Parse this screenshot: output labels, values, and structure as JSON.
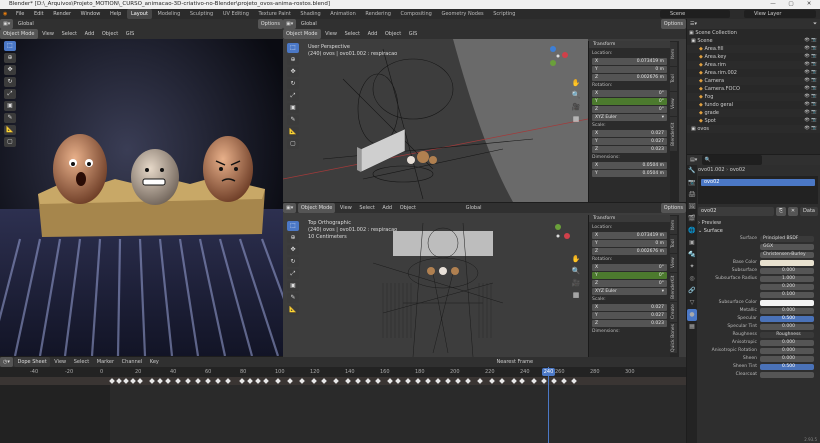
{
  "title": "Blender* [D:\\_Arquivos\\Projeto_MOTION\\_CURSO_animacao-3D-criativo-no-Blender\\projeto_ovos-anima-rostos.blend]",
  "window_controls": [
    "—",
    "▢",
    "✕"
  ],
  "menu": [
    "File",
    "Edit",
    "Render",
    "Window",
    "Help"
  ],
  "workspaces": [
    "Layout",
    "Modeling",
    "Sculpting",
    "UV Editing",
    "Texture Paint",
    "Shading",
    "Animation",
    "Rendering",
    "Compositing",
    "Geometry Nodes",
    "Scripting"
  ],
  "scene": {
    "name": "Scene",
    "view_layer": "View Layer"
  },
  "camera_view": {
    "header": [
      "Global",
      "Options"
    ],
    "header2": [
      "Object Mode",
      "View",
      "Select",
      "Add",
      "Object",
      "GIS"
    ]
  },
  "viewport_top": {
    "mode": "Object Mode",
    "menus": [
      "View",
      "Select",
      "Add",
      "Object"
    ],
    "gis": "GIS",
    "orientation": "Global",
    "options": "Options",
    "view_name": "User Perspective",
    "info": "(240) ovos | ovo01.002 : respiracao",
    "panel": {
      "title": "Transform",
      "location_label": "Location:",
      "location": [
        [
          "X",
          "0.073419 m"
        ],
        [
          "Y",
          "0 m"
        ],
        [
          "Z",
          "0.002676 m"
        ]
      ],
      "rotation_label": "Rotation:",
      "rotation": [
        [
          "X",
          "0°"
        ],
        [
          "Y",
          "0°"
        ],
        [
          "Z",
          "0°"
        ]
      ],
      "rotation_mode": "XYZ Euler",
      "scale_label": "Scale:",
      "scale": [
        [
          "X",
          "0.027"
        ],
        [
          "Y",
          "0.027"
        ],
        [
          "Z",
          "0.023"
        ]
      ],
      "dimensions_label": "Dimensions:",
      "dimensions": [
        [
          "X",
          "0.0504 m"
        ],
        [
          "Y",
          "0.0504 m"
        ]
      ]
    },
    "tabs": [
      "Item",
      "Tool",
      "View",
      "BlenderKit"
    ]
  },
  "viewport_bottom": {
    "mode": "Object Mode",
    "menus": [
      "View",
      "Select",
      "Add",
      "Object"
    ],
    "gis": "GIS",
    "orientation": "Global",
    "options": "Options",
    "view_name": "Top Orthographic",
    "info": "(240) ovos | ovo01.002 : respiracao",
    "scale_info": "10 Centimeters",
    "panel": {
      "title": "Transform",
      "location_label": "Location:",
      "location": [
        [
          "X",
          "0.073419 m"
        ],
        [
          "Y",
          "0 m"
        ],
        [
          "Z",
          "0.002676 m"
        ]
      ],
      "rotation_label": "Rotation:",
      "rotation": [
        [
          "X",
          "0°"
        ],
        [
          "Y",
          "0°"
        ],
        [
          "Z",
          "0°"
        ]
      ],
      "rotation_mode": "XYZ Euler",
      "scale_label": "Scale:",
      "scale": [
        [
          "X",
          "0.027"
        ],
        [
          "Y",
          "0.027"
        ],
        [
          "Z",
          "0.023"
        ]
      ],
      "dimensions_label": "Dimensions:"
    },
    "tabs": [
      "Item",
      "Tool",
      "View",
      "BlenderKit",
      "Create",
      "Quick Bones"
    ]
  },
  "outliner": {
    "title": "Scene Collection",
    "items": [
      {
        "name": "Scene",
        "indent": 0
      },
      {
        "name": "Area.fill",
        "indent": 1
      },
      {
        "name": "Area.key",
        "indent": 1
      },
      {
        "name": "Area.rim",
        "indent": 1
      },
      {
        "name": "Area.rim.002",
        "indent": 1
      },
      {
        "name": "Camera",
        "indent": 1
      },
      {
        "name": "Camera.FOCO",
        "indent": 1
      },
      {
        "name": "Fog",
        "indent": 1
      },
      {
        "name": "fundo geral",
        "indent": 1
      },
      {
        "name": "grade",
        "indent": 1
      },
      {
        "name": "Spot",
        "indent": 1
      },
      {
        "name": "ovos",
        "indent": 0
      }
    ]
  },
  "properties": {
    "object": "ovo01.002",
    "material_tab": "ovo02",
    "slot": "ovo02",
    "material_name": "ovo02",
    "data_label": "Data",
    "preview_label": "Preview",
    "surface_label": "Surface",
    "surface_shader": "Principled BSDF",
    "distribution": "GGX",
    "subsurface_method": "Christensen-Burley",
    "rows": [
      {
        "label": "Base Color",
        "value": "",
        "style": "light"
      },
      {
        "label": "Subsurface",
        "value": "0.000",
        "style": "norm"
      },
      {
        "label": "Subsurface Radius",
        "value": "1.000",
        "style": "norm"
      },
      {
        "label": "",
        "value": "0.200",
        "style": "norm"
      },
      {
        "label": "",
        "value": "0.100",
        "style": "norm"
      },
      {
        "label": "Subsurface Color",
        "value": "",
        "style": "white"
      },
      {
        "label": "Metallic",
        "value": "0.000",
        "style": "norm"
      },
      {
        "label": "Specular",
        "value": "0.500",
        "style": "blue"
      },
      {
        "label": "Specular Tint",
        "value": "0.000",
        "style": "norm"
      },
      {
        "label": "Roughness",
        "value": "Roughness",
        "style": "dark"
      },
      {
        "label": "Anisotropic",
        "value": "0.000",
        "style": "norm"
      },
      {
        "label": "Anisotropic Rotation",
        "value": "0.000",
        "style": "norm"
      },
      {
        "label": "Sheen",
        "value": "0.000",
        "style": "norm"
      },
      {
        "label": "Sheen Tint",
        "value": "0.500",
        "style": "blue"
      },
      {
        "label": "Clearcoat",
        "value": "",
        "style": "norm"
      }
    ],
    "version": "2.93.5"
  },
  "timeline": {
    "editor": "Dope Sheet",
    "menus": [
      "View",
      "Select",
      "Marker",
      "Channel",
      "Key"
    ],
    "snap": "Nearest Frame",
    "ticks": [
      "-40",
      "-20",
      "0",
      "20",
      "40",
      "60",
      "80",
      "100",
      "120",
      "140",
      "160",
      "180",
      "200",
      "220",
      "240",
      "260",
      "280",
      "300"
    ],
    "current_frame": "240"
  },
  "colors": {
    "accent": "#4b78c6",
    "frame_marker": "#3d6fd1",
    "header": "#303030"
  }
}
